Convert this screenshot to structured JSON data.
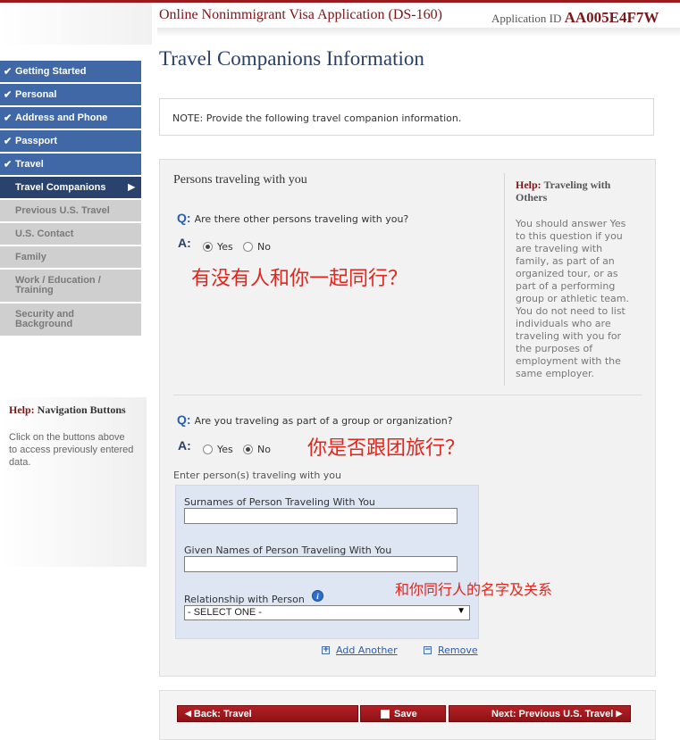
{
  "header": {
    "app_title": "Online Nonimmigrant Visa Application (DS-160)",
    "app_id_label": "Application ID",
    "app_id": "AA005E4F7W"
  },
  "nav": {
    "items": [
      {
        "label": "Getting Started",
        "state": "done"
      },
      {
        "label": "Personal",
        "state": "done"
      },
      {
        "label": "Address and Phone",
        "state": "done"
      },
      {
        "label": "Passport",
        "state": "done"
      },
      {
        "label": "Travel",
        "state": "done"
      },
      {
        "label": "Travel Companions",
        "state": "current"
      },
      {
        "label": "Previous U.S. Travel",
        "state": "todo"
      },
      {
        "label": "U.S. Contact",
        "state": "todo"
      },
      {
        "label": "Family",
        "state": "todo"
      },
      {
        "label": "Work / Education / Training",
        "state": "todo"
      },
      {
        "label": "Security and Background",
        "state": "todo"
      }
    ],
    "help_title_prefix": "Help:",
    "help_title": "Navigation Buttons",
    "help_text": "Click on the buttons above to access previously entered data."
  },
  "page": {
    "title": "Travel Companions Information",
    "note": "NOTE: Provide the following travel companion information."
  },
  "section": {
    "title": "Persons traveling with you",
    "help_title_prefix": "Help:",
    "help_title": "Traveling with Others",
    "help_text": "You should answer Yes to this question if you are traveling with family, as part of an organized tour, or as part of a performing group or athletic team. You do not need to list individuals who are traveling with you for the purposes of employment with the same employer."
  },
  "q1": {
    "q_marker": "Q:",
    "text": "Are there other persons traveling with you?",
    "a_marker": "A:",
    "yes": "Yes",
    "no": "No",
    "selected": "Yes",
    "annotation": "有没有人和你一起同行？"
  },
  "q2": {
    "q_marker": "Q:",
    "text": "Are you traveling as part of a group or organization?",
    "a_marker": "A:",
    "yes": "Yes",
    "no": "No",
    "selected": "No",
    "annotation": "你是否跟团旅行？"
  },
  "companions": {
    "label": "Enter person(s) traveling with you",
    "surname_label": "Surnames of Person Traveling With You",
    "surname_value": "",
    "given_label": "Given Names of Person Traveling With You",
    "given_value": "",
    "relationship_label": "Relationship with Person",
    "relationship_value": "- SELECT ONE -",
    "annotation": "和你同行人的名字及关系",
    "add_another": "Add Another",
    "remove": "Remove"
  },
  "buttons": {
    "back": "Back: Travel",
    "save": "Save",
    "next": "Next: Previous U.S. Travel"
  },
  "colors": {
    "nav_done": "#4068a6",
    "nav_current": "#2a436d",
    "nav_todo": "#cfcfcf",
    "brand_red": "#9a1b1e",
    "annotation_red": "#e0261d"
  }
}
